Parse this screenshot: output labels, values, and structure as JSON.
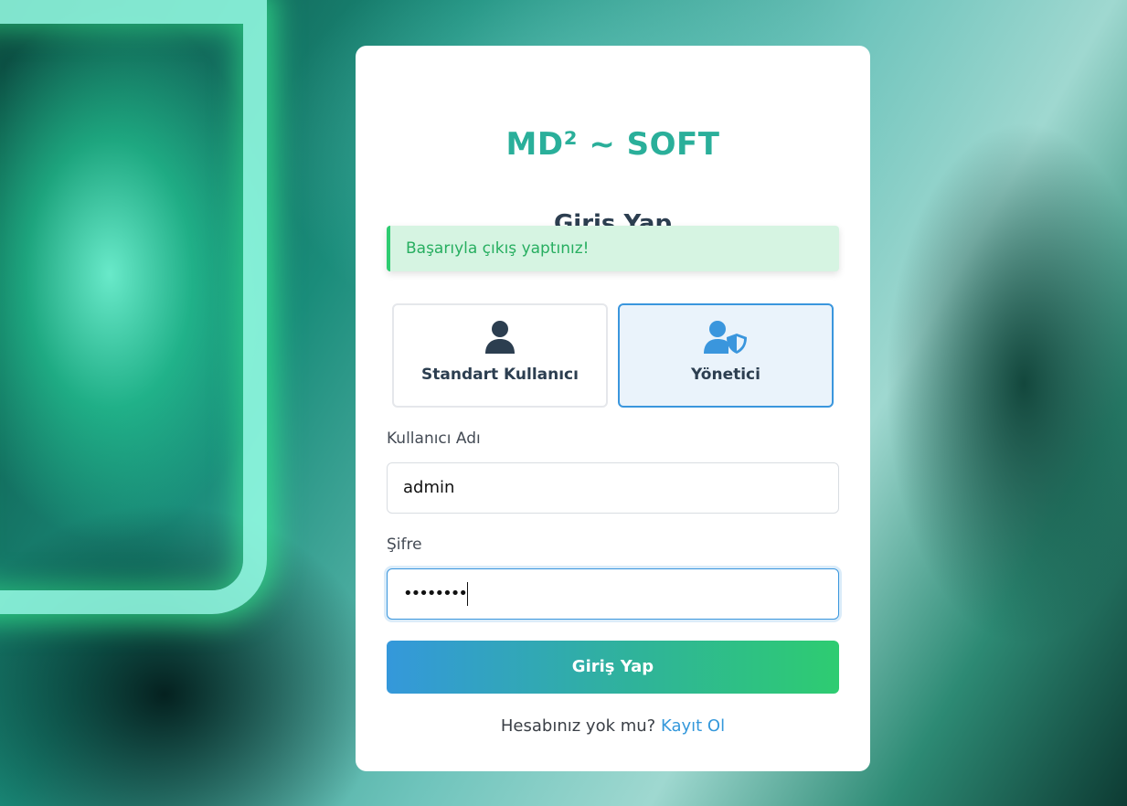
{
  "brand": "MD² ~ SOFT",
  "title": "Giriş Yap",
  "alert": {
    "message": "Başarıyla çıkış yaptınız!"
  },
  "roles": [
    {
      "label": "Standart Kullanıcı",
      "icon": "user-icon",
      "selected": false
    },
    {
      "label": "Yönetici",
      "icon": "user-shield-icon",
      "selected": true
    }
  ],
  "username": {
    "label": "Kullanıcı Adı",
    "value": "admin"
  },
  "password": {
    "label": "Şifre",
    "masked_value": "••••••••"
  },
  "submit_label": "Giriş Yap",
  "footer": {
    "text": "Hesabınız yok mu?",
    "link": "Kayıt Ol"
  },
  "colors": {
    "brand": "#2aaf9a",
    "accent_blue": "#3498db",
    "accent_green": "#2ecc71",
    "alert_bg": "#d6f4e2"
  }
}
